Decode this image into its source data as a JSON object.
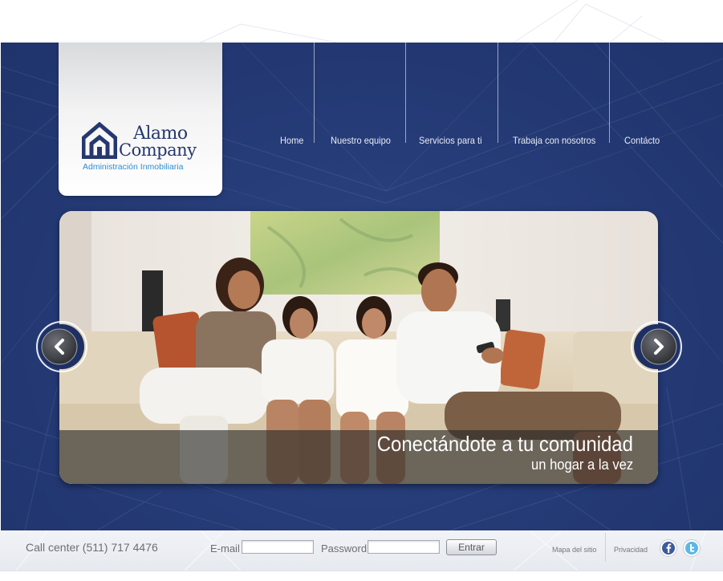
{
  "brand": {
    "name_line1": "Alamo",
    "name_line2": "Company",
    "tagline": "Administración Inmobiliaria",
    "colors": {
      "primary": "#25386f",
      "accent": "#2d8fd0"
    },
    "icon": "house-logo-icon"
  },
  "nav": {
    "items": [
      {
        "label": "Home"
      },
      {
        "label": "Nuestro equipo"
      },
      {
        "label": "Servicios para ti"
      },
      {
        "label": "Trabaja con nosotros"
      },
      {
        "label": "Contácto"
      }
    ]
  },
  "slider": {
    "caption_title": "Conectándote a tu comunidad",
    "caption_subtitle": "un hogar a la vez",
    "prev_icon": "chevron-left-icon",
    "next_icon": "chevron-right-icon"
  },
  "footer": {
    "call_center": "Call center (511) 717 4476",
    "email_label": "E-mail",
    "email_value": "",
    "password_label": "Password",
    "password_value": "",
    "submit_label": "Entrar",
    "sitemap_link": "Mapa del sitio",
    "privacy_link": "Privacidad",
    "social_icons": [
      "facebook-icon",
      "twitter-icon"
    ]
  }
}
